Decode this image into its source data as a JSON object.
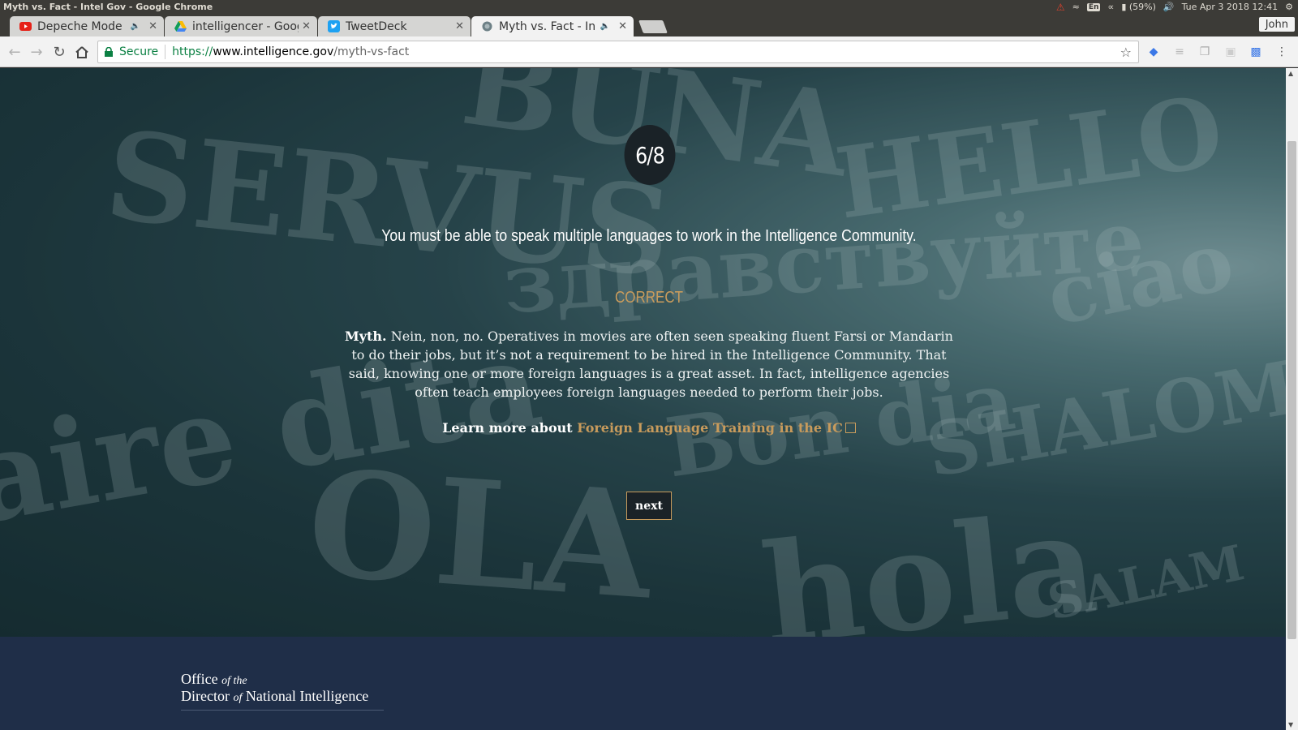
{
  "os": {
    "window_title": "Myth vs. Fact - Intel Gov - Google Chrome",
    "lang": "En",
    "battery": "(59%)",
    "datetime": "Tue Apr  3 2018 12:41"
  },
  "browser": {
    "tabs": [
      {
        "title": "Depeche Mode - I",
        "icon": "youtube-icon",
        "audio": true
      },
      {
        "title": "intelligencer - Goog",
        "icon": "google-drive-icon",
        "audio": false
      },
      {
        "title": "TweetDeck",
        "icon": "twitter-icon",
        "audio": false
      },
      {
        "title": "Myth vs. Fact - Int",
        "icon": "globe-icon",
        "audio": true,
        "active": true
      }
    ],
    "profile": "John",
    "secure_label": "Secure",
    "url_scheme": "https://",
    "url_host": "www.intelligence.gov",
    "url_path": "/myth-vs-fact"
  },
  "quiz": {
    "counter": "6/8",
    "question": "You must be able to speak multiple languages to work in the Intelligence Community.",
    "verdict": "CORRECT",
    "answer_lead": "Myth.",
    "answer_body": " Nein, non, no. Operatives in movies are often seen speaking fluent Farsi or Mandarin to do their jobs, but it’s not a requirement to be hired in the Intelligence Community. That said, knowing one or more foreign languages is a great asset. In fact, intelligence agencies often teach employees foreign languages needed to perform their jobs.",
    "learn_prefix": "Learn more about ",
    "learn_link": "Foreign Language Training in the IC",
    "next_label": "next"
  },
  "background_words": [
    "SERVUS",
    "BUNA",
    "HELLO",
    "здравствуйте",
    "Bon dia",
    "SHALOM",
    "OLA",
    "hola",
    "ciao",
    "SALAM",
    "aire dita"
  ],
  "footer": {
    "org_line1_main": "Office",
    "org_line1_small": "of the",
    "org_line2_a": "Director",
    "org_line2_small": "of",
    "org_line2_b": "National Intelligence"
  },
  "colors": {
    "accent": "#c89b5c",
    "footer_bg": "#1f2e48",
    "secure_green": "#0b8043"
  }
}
